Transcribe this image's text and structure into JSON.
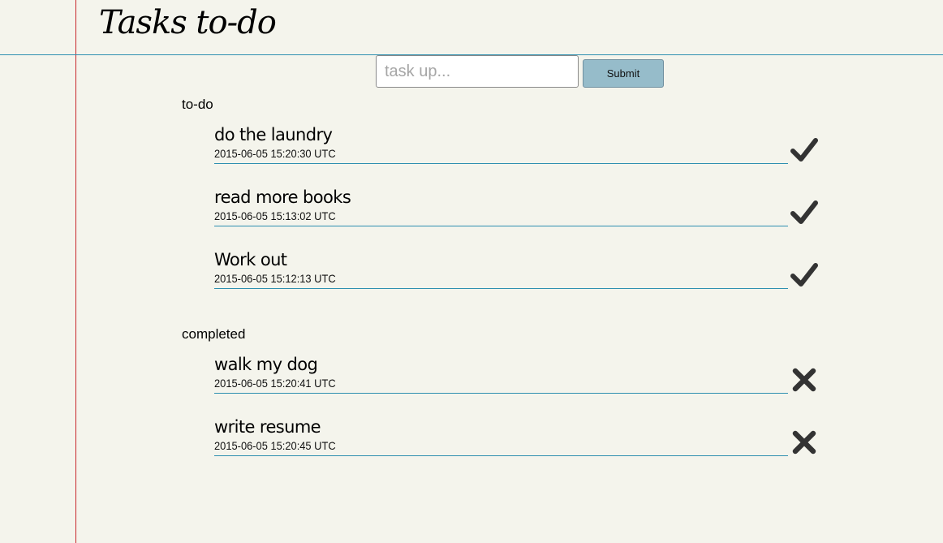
{
  "header": {
    "title": "Tasks to-do"
  },
  "form": {
    "placeholder": "task up...",
    "value": "",
    "submit_label": "Submit"
  },
  "sections": {
    "todo": {
      "heading": "to-do",
      "action_icon": "check-icon",
      "tasks": [
        {
          "name": "do the laundry",
          "timestamp": "2015-06-05 15:20:30 UTC"
        },
        {
          "name": "read more books",
          "timestamp": "2015-06-05 15:13:02 UTC"
        },
        {
          "name": "Work out",
          "timestamp": "2015-06-05 15:12:13 UTC"
        }
      ]
    },
    "completed": {
      "heading": "completed",
      "action_icon": "cross-icon",
      "tasks": [
        {
          "name": "walk my dog",
          "timestamp": "2015-06-05 15:20:41 UTC"
        },
        {
          "name": "write resume",
          "timestamp": "2015-06-05 15:20:45 UTC"
        }
      ]
    }
  },
  "colors": {
    "background": "#f4f4ec",
    "margin_line": "#c8262b",
    "rule_line": "#2d8fb0",
    "button": "#96bcca",
    "icon": "#333333"
  }
}
